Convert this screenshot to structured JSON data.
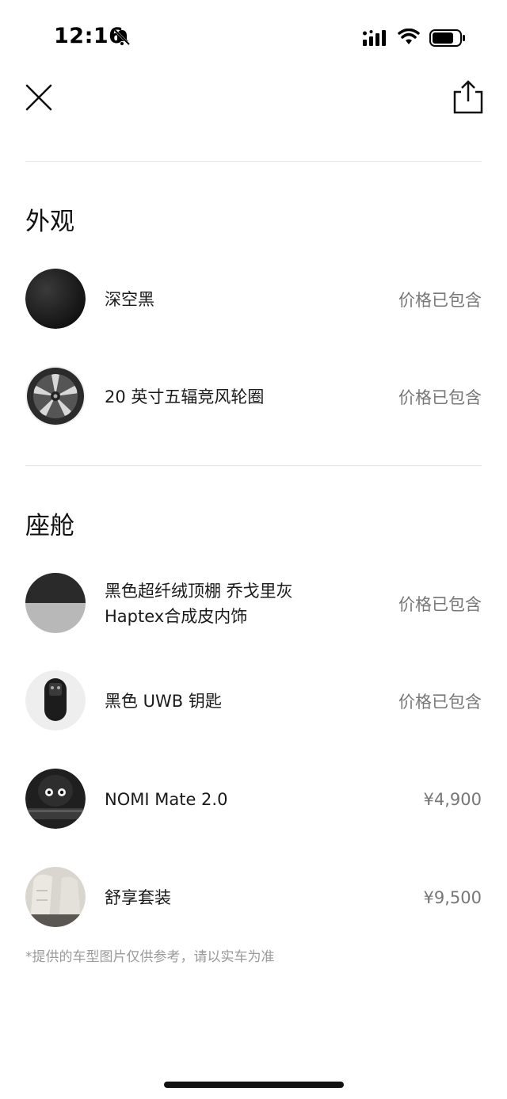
{
  "status_bar": {
    "time": "12:16"
  },
  "header": {
    "close_icon": "close-icon",
    "share_icon": "share-icon"
  },
  "sections": [
    {
      "title": "外观",
      "items": [
        {
          "name_lines": [
            "深空黑"
          ],
          "price": "价格已包含",
          "icon": "black-paint-swatch"
        },
        {
          "name_lines": [
            "20 英寸五辐竞风轮圈"
          ],
          "price": "价格已包含",
          "icon": "wheel-rim"
        }
      ]
    },
    {
      "title": "座舱",
      "items": [
        {
          "name_lines": [
            "黑色超纤绒顶棚 乔戈里灰",
            "Haptex合成皮内饰"
          ],
          "price": "价格已包含",
          "icon": "interior-swatch"
        },
        {
          "name_lines": [
            "黑色 UWB 钥匙"
          ],
          "price": "价格已包含",
          "icon": "uwb-key"
        },
        {
          "name_lines": [
            "NOMI Mate 2.0"
          ],
          "price": "¥4,900",
          "icon": "nomi-robot"
        },
        {
          "name_lines": [
            "舒享套装"
          ],
          "price": "¥9,500",
          "icon": "comfort-seat"
        }
      ]
    }
  ],
  "disclaimer": "*提供的车型图片仅供参考，请以实车为准",
  "colors": {
    "text": "#1a1a1a",
    "price": "#777777",
    "divider": "#e6e6e6",
    "disclaimer": "#9a9a9a"
  }
}
